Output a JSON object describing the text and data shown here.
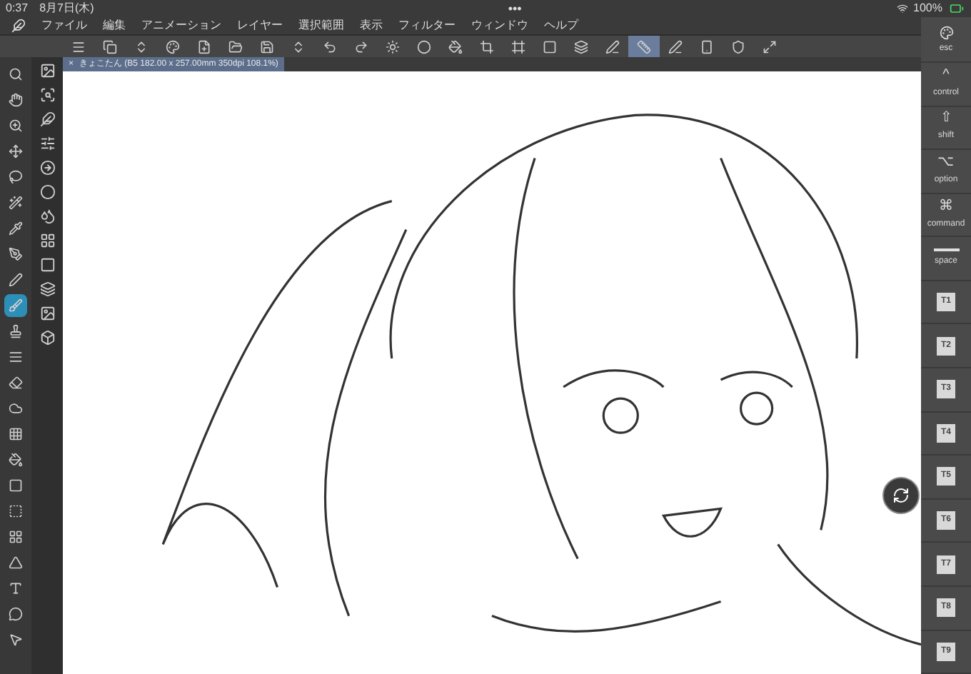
{
  "status_bar": {
    "time": "0:37",
    "date": "8月7日(木)",
    "handle": "•••",
    "battery": "100%"
  },
  "menu_bar": {
    "items": [
      "ファイル",
      "編集",
      "アニメーション",
      "レイヤー",
      "選択範囲",
      "表示",
      "フィルター",
      "ウィンドウ",
      "ヘルプ"
    ]
  },
  "command_bar": {
    "buttons": [
      {
        "selected": false
      },
      {
        "selected": false
      },
      {
        "selected": false
      },
      {
        "selected": false
      },
      {
        "selected": false
      },
      {
        "selected": false
      },
      {
        "selected": false
      },
      {
        "selected": false
      },
      {
        "selected": false
      },
      {
        "selected": false
      },
      {
        "selected": false
      },
      {
        "selected": false
      },
      {
        "selected": false
      },
      {
        "selected": false
      },
      {
        "selected": false
      },
      {
        "selected": false
      },
      {
        "selected": false
      },
      {
        "selected": false
      },
      {
        "selected": true
      },
      {
        "selected": false
      },
      {
        "selected": false
      },
      {
        "selected": false
      },
      {
        "selected": false
      }
    ]
  },
  "canvas_tab": {
    "close": "×",
    "title": "きょこたん (B5 182.00 x 257.00mm 350dpi 108.1%)"
  },
  "tool_bar": {
    "tools": [
      {
        "selected": false
      },
      {
        "selected": false
      },
      {
        "selected": false
      },
      {
        "selected": false
      },
      {
        "selected": false
      },
      {
        "selected": false
      },
      {
        "selected": false
      },
      {
        "selected": false
      },
      {
        "selected": false
      },
      {
        "selected": true
      },
      {
        "selected": false
      },
      {
        "selected": false
      },
      {
        "selected": false
      },
      {
        "selected": false
      },
      {
        "selected": false
      },
      {
        "selected": false
      },
      {
        "selected": false
      },
      {
        "selected": false
      },
      {
        "selected": false
      },
      {
        "selected": false
      },
      {
        "selected": false
      },
      {
        "selected": false
      },
      {
        "selected": false
      }
    ]
  },
  "edge_keyboard": {
    "keys": [
      {
        "kind": "symbol",
        "symbol": "^",
        "label": "control"
      },
      {
        "kind": "symbol",
        "symbol": "⇧",
        "label": "shift"
      },
      {
        "kind": "symbol",
        "symbol": "⌥",
        "label": "option"
      },
      {
        "kind": "symbol",
        "symbol": "⌘",
        "label": "command"
      },
      {
        "kind": "bar",
        "label": "space"
      },
      {
        "kind": "chip",
        "label": "T1"
      },
      {
        "kind": "chip",
        "label": "T2"
      },
      {
        "kind": "chip",
        "label": "T3"
      },
      {
        "kind": "chip",
        "label": "T4"
      },
      {
        "kind": "chip",
        "label": "T5"
      },
      {
        "kind": "chip",
        "label": "T6"
      },
      {
        "kind": "chip",
        "label": "T7"
      },
      {
        "kind": "chip",
        "label": "T8"
      },
      {
        "kind": "chip",
        "label": "T9"
      }
    ],
    "esc": "esc"
  }
}
